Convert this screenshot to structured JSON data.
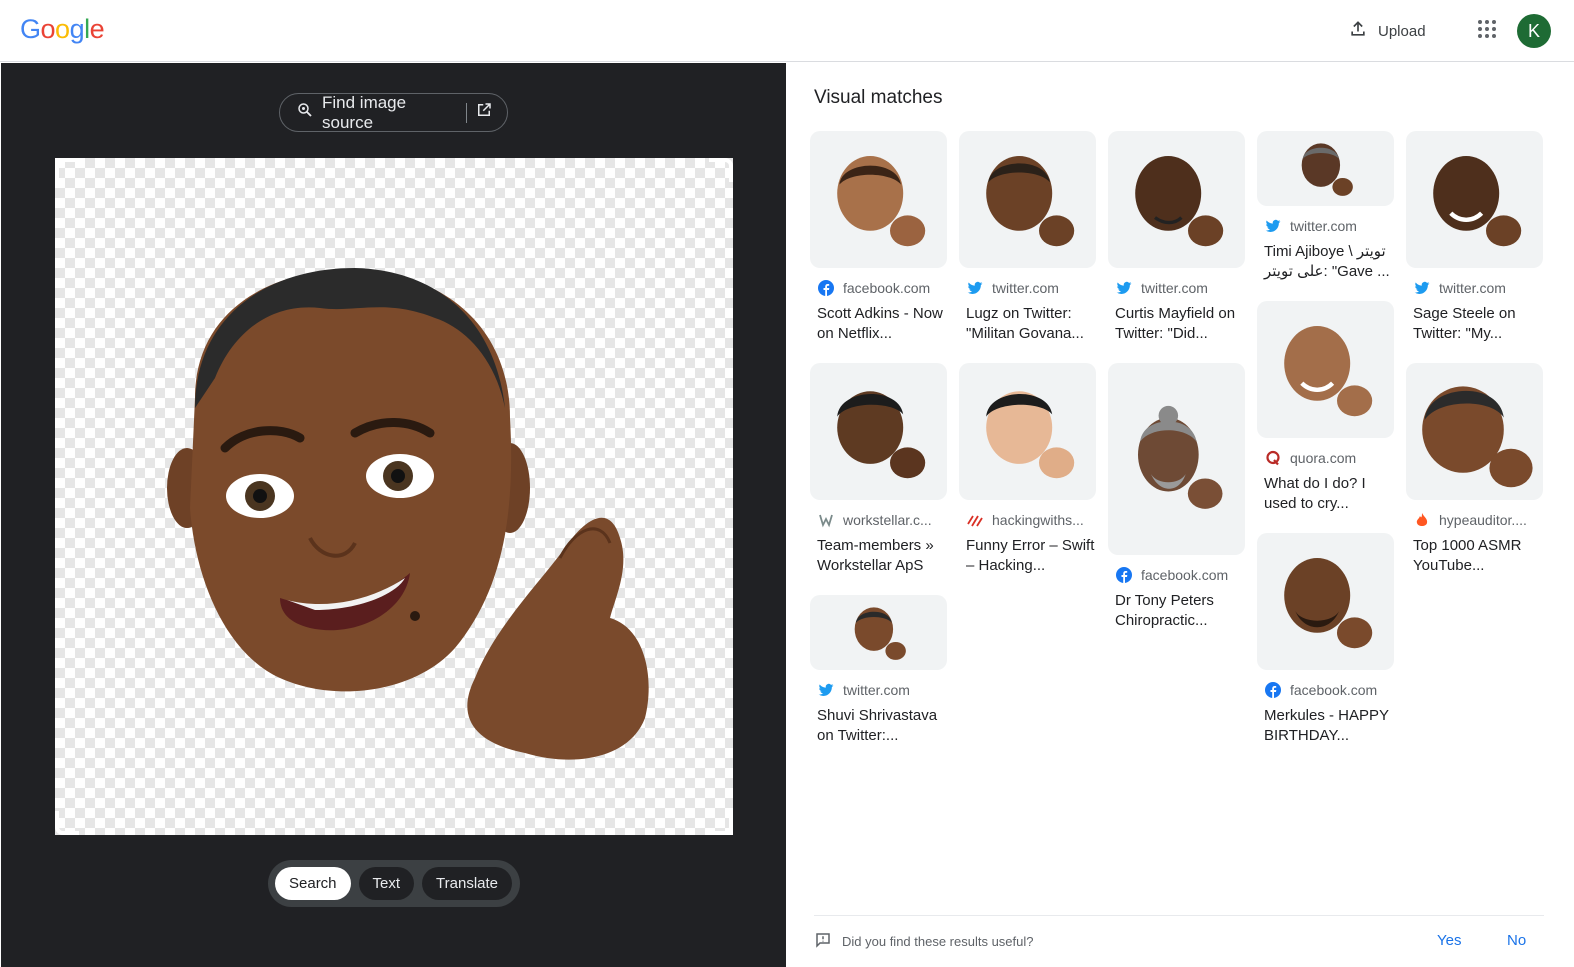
{
  "header": {
    "logo": "Google",
    "logo_colors": [
      "#4285F4",
      "#EA4335",
      "#FBBC05",
      "#4285F4",
      "#34A853",
      "#EA4335"
    ],
    "upload_label": "Upload",
    "upload_icon": "upload-icon",
    "apps_icon": "apps-grid-icon",
    "avatar_letter": "K",
    "avatar_color": "#1e6b34"
  },
  "left": {
    "find_source_label": "Find image source",
    "modes": [
      {
        "label": "Search",
        "active": true
      },
      {
        "label": "Text",
        "active": false
      },
      {
        "label": "Translate",
        "active": false
      }
    ]
  },
  "right": {
    "title": "Visual matches",
    "cards": [
      {
        "source": "facebook.com",
        "icon": "facebook-icon",
        "title": "Scott Adkins - Now on Netflix..."
      },
      {
        "source": "twitter.com",
        "icon": "twitter-icon",
        "title": "Lugz on Twitter: \"Militan Govana..."
      },
      {
        "source": "twitter.com",
        "icon": "twitter-icon",
        "title": "Curtis Mayfield on Twitter: \"Did..."
      },
      {
        "source": "twitter.com",
        "icon": "twitter-icon",
        "title": "Timi Ajiboye \\ تويتر على تويتر: \"Gave ..."
      },
      {
        "source": "twitter.com",
        "icon": "twitter-icon",
        "title": "Sage Steele on Twitter: \"My..."
      },
      {
        "source": "workstellar.c...",
        "icon": "workstellar-icon",
        "title": "Team-members » Workstellar ApS"
      },
      {
        "source": "hackingwiths...",
        "icon": "hackingwithswift-icon",
        "title": "Funny Error – Swift – Hacking..."
      },
      {
        "source": "facebook.com",
        "icon": "facebook-icon",
        "title": "Dr Tony Peters Chiropractic..."
      },
      {
        "source": "quora.com",
        "icon": "quora-icon",
        "title": "What do I do? I used to cry..."
      },
      {
        "source": "hypeauditor....",
        "icon": "hypeauditor-icon",
        "title": "Top 1000 ASMR YouTube..."
      },
      {
        "source": "twitter.com",
        "icon": "twitter-icon",
        "title": "Shuvi Shrivastava on Twitter:..."
      },
      {
        "source": "facebook.com",
        "icon": "facebook-icon",
        "title": "Merkules - HAPPY BIRTHDAY..."
      }
    ],
    "feedback": {
      "question": "Did you find these results useful?",
      "yes": "Yes",
      "no": "No"
    }
  }
}
